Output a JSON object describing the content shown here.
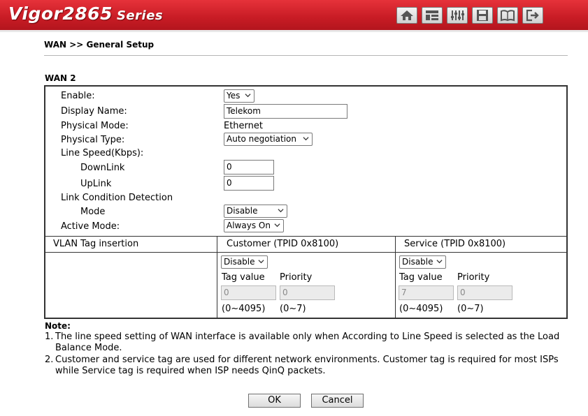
{
  "header": {
    "brand_model": "Vigor2865",
    "brand_series": "Series",
    "toolbar_icons": [
      "home-icon",
      "dashboard-icon",
      "settings-icon",
      "save-icon",
      "manual-icon",
      "logout-icon"
    ]
  },
  "breadcrumb": "WAN >> General Setup",
  "section": "WAN 2",
  "form": {
    "enable_label": "Enable:",
    "enable_value": "Yes",
    "display_name_label": "Display Name:",
    "display_name_value": "Telekom",
    "physical_mode_label": "Physical Mode:",
    "physical_mode_value": "Ethernet",
    "physical_type_label": "Physical Type:",
    "physical_type_value": "Auto negotiation",
    "line_speed_label": "Line Speed(Kbps):",
    "downlink_label": "DownLink",
    "downlink_value": "0",
    "uplink_label": "UpLink",
    "uplink_value": "0",
    "lcd_label": "Link Condition Detection",
    "mode_label": "Mode",
    "mode_value": "Disable",
    "active_mode_label": "Active Mode:",
    "active_mode_value": "Always On"
  },
  "vlan": {
    "header_label": "VLAN Tag insertion",
    "customer_header": "Customer (TPID 0x8100)",
    "service_header": "Service (TPID 0x8100)",
    "customer": {
      "select_value": "Disable",
      "tag_value_label": "Tag value",
      "priority_label": "Priority",
      "tag_value": "0",
      "priority_value": "0",
      "tag_range": "(0~4095)",
      "priority_range": "(0~7)"
    },
    "service": {
      "select_value": "Disable",
      "tag_value_label": "Tag value",
      "priority_label": "Priority",
      "tag_value": "7",
      "priority_value": "0",
      "tag_range": "(0~4095)",
      "priority_range": "(0~7)"
    }
  },
  "notes": {
    "title": "Note:",
    "items": [
      {
        "num": "1.",
        "text": "The line speed setting of WAN interface is available only when According to Line Speed is selected as the Load Balance Mode."
      },
      {
        "num": "2.",
        "text": "Customer and service tag are used for different network environments. Customer tag is required for most ISPs while Service tag is required when ISP needs QinQ packets."
      }
    ]
  },
  "buttons": {
    "ok": "OK",
    "cancel": "Cancel"
  }
}
